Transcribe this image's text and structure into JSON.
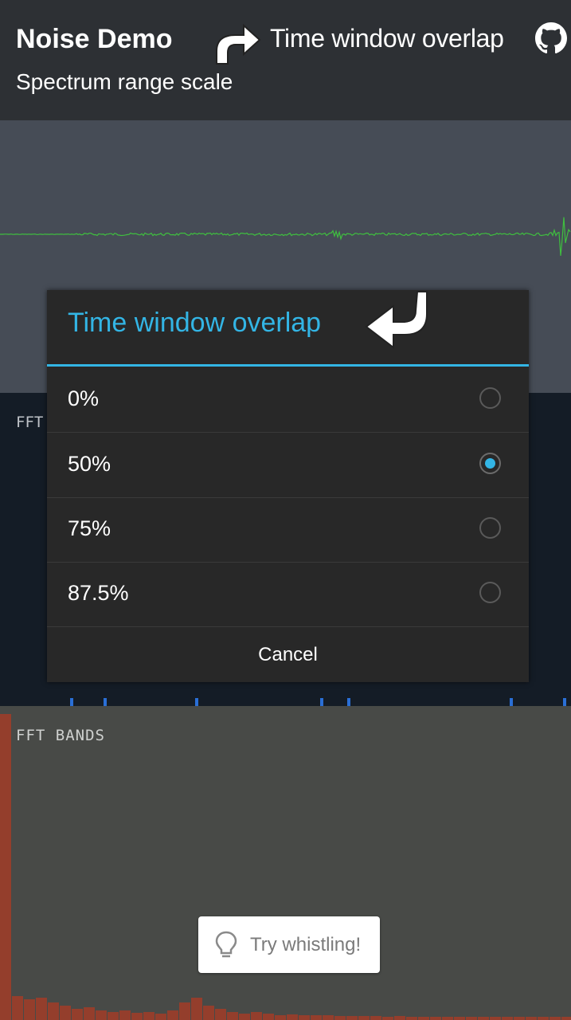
{
  "header": {
    "app_title": "Noise Demo",
    "subtitle": "Spectrum range scale",
    "menu_label": "Time window overlap",
    "icons": [
      "arrow-redo-icon",
      "github-icon"
    ]
  },
  "panels": {
    "fft_label": "FFT",
    "bands_label": "FFT BANDS"
  },
  "dialog": {
    "title": "Time window overlap",
    "options": [
      {
        "label": "0%",
        "selected": false
      },
      {
        "label": "50%",
        "selected": true
      },
      {
        "label": "75%",
        "selected": false
      },
      {
        "label": "87.5%",
        "selected": false
      }
    ],
    "cancel_label": "Cancel",
    "accent_color": "#33b5e5"
  },
  "toast": {
    "text": "Try whistling!",
    "icon": "lightbulb-icon"
  },
  "colors": {
    "waveform": "#3fbf3f",
    "bands": "#a23c28",
    "fft_spikes": "#2a6fd6"
  }
}
